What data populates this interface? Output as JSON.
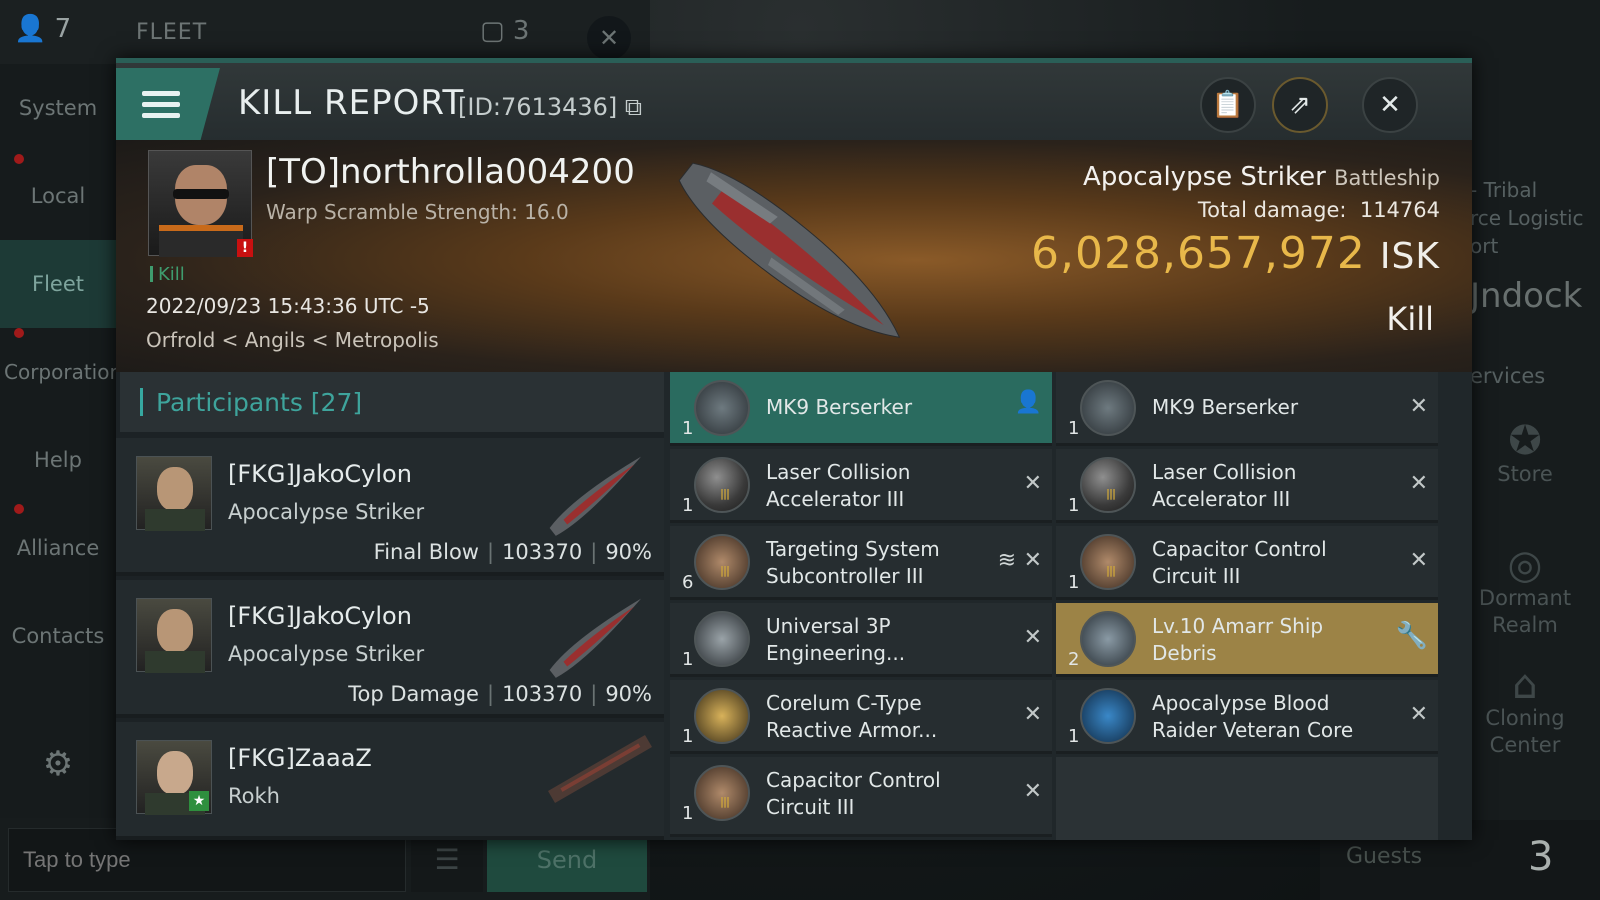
{
  "topbar": {
    "count": "7",
    "fleet_label": "FLEET",
    "square_count": "3"
  },
  "leftnav": [
    {
      "label": "System"
    },
    {
      "label": "Local"
    },
    {
      "label": "Fleet"
    },
    {
      "label": "Corporation"
    },
    {
      "label": "Help"
    },
    {
      "label": "Alliance"
    },
    {
      "label": "Contacts"
    }
  ],
  "chat": {
    "placeholder": "Tap to type",
    "send_label": "Send"
  },
  "rightpane": {
    "tribal_l1": "- Tribal",
    "tribal_l2": "rce Logistic",
    "tribal_l3": "ort",
    "undock": "Jndock",
    "services": "ervices",
    "store": "Store",
    "dormant_l1": "Dormant",
    "dormant_l2": "Realm",
    "cloning_l1": "Cloning",
    "cloning_l2": "Center",
    "guests": "Guests",
    "guests_count": "3"
  },
  "header": {
    "title": "KILL REPORT",
    "id": "[ID:7613436]"
  },
  "victim": {
    "name": "[TO]northrolla004200",
    "warp": "Warp Scramble Strength: 16.0",
    "tag": "Kill",
    "date": "2022/09/23 15:43:36 UTC -5",
    "location": "Orfrold < Angils < Metropolis",
    "ship": "Apocalypse Striker",
    "ship_class": "Battleship",
    "total_damage_label": "Total damage:",
    "total_damage": "114764",
    "isk": "6,028,657,972",
    "isk_unit": "ISK",
    "result": "Kill"
  },
  "participants": {
    "title": "Participants [27]",
    "rows": [
      {
        "name": "[FKG]JakoCylon",
        "ship": "Apocalypse Striker",
        "role": "Final Blow",
        "damage": "103370",
        "pct": "90%"
      },
      {
        "name": "[FKG]JakoCylon",
        "ship": "Apocalypse Striker",
        "role": "Top Damage",
        "damage": "103370",
        "pct": "90%"
      },
      {
        "name": "[FKG]ZaaaZ",
        "ship": "Rokh",
        "role": "",
        "damage": "",
        "pct": ""
      }
    ]
  },
  "items_left": [
    {
      "qty": "1",
      "l1": "MK9  Berserker",
      "l2": ""
    },
    {
      "qty": "1",
      "l1": "Laser Collision",
      "l2": "Accelerator III"
    },
    {
      "qty": "6",
      "l1": "Targeting System",
      "l2": "Subcontroller III"
    },
    {
      "qty": "1",
      "l1": "Universal 3P",
      "l2": "Engineering..."
    },
    {
      "qty": "1",
      "l1": "Corelum C-Type",
      "l2": "Reactive Armor..."
    },
    {
      "qty": "1",
      "l1": "Capacitor Control",
      "l2": "Circuit III"
    }
  ],
  "items_right": [
    {
      "qty": "1",
      "l1": "MK9  Berserker",
      "l2": ""
    },
    {
      "qty": "1",
      "l1": "Laser Collision",
      "l2": "Accelerator III"
    },
    {
      "qty": "1",
      "l1": "Capacitor Control",
      "l2": "Circuit III"
    },
    {
      "qty": "2",
      "l1": "Lv.10 Amarr Ship",
      "l2": "Debris"
    },
    {
      "qty": "1",
      "l1": "Apocalypse Blood",
      "l2": "Raider Veteran Core"
    }
  ]
}
